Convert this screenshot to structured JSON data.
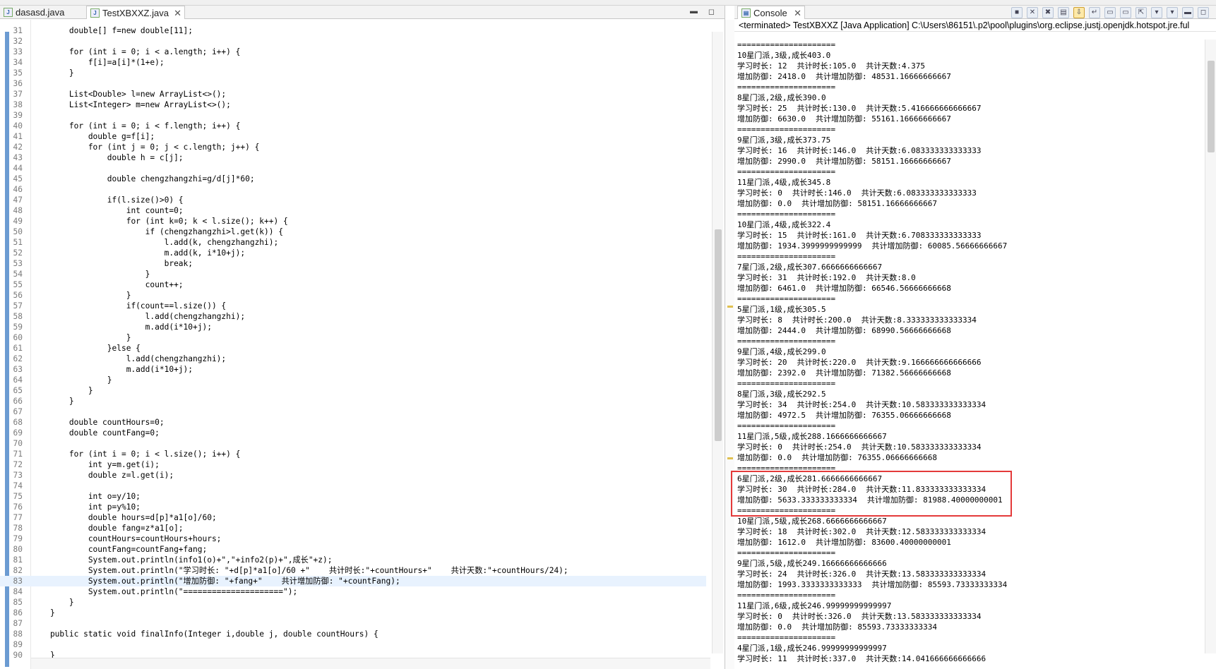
{
  "editor": {
    "tabs": [
      {
        "label": "dasasd.java",
        "active": false
      },
      {
        "label": "TestXBXXZ.java",
        "active": true
      }
    ],
    "code_lines": [
      {
        "n": "31",
        "t": "        double[] f=new double[11];"
      },
      {
        "n": "32",
        "t": ""
      },
      {
        "n": "33",
        "t": "        for (int i = 0; i < a.length; i++) {"
      },
      {
        "n": "34",
        "t": "            f[i]=a[i]*(1+e);"
      },
      {
        "n": "35",
        "t": "        }"
      },
      {
        "n": "36",
        "t": ""
      },
      {
        "n": "37",
        "t": "        List<Double> l=new ArrayList<>();"
      },
      {
        "n": "38",
        "t": "        List<Integer> m=new ArrayList<>();"
      },
      {
        "n": "39",
        "t": ""
      },
      {
        "n": "40",
        "t": "        for (int i = 0; i < f.length; i++) {"
      },
      {
        "n": "41",
        "t": "            double g=f[i];"
      },
      {
        "n": "42",
        "t": "            for (int j = 0; j < c.length; j++) {"
      },
      {
        "n": "43",
        "t": "                double h = c[j];"
      },
      {
        "n": "44",
        "t": ""
      },
      {
        "n": "45",
        "t": "                double chengzhangzhi=g/d[j]*60;"
      },
      {
        "n": "46",
        "t": ""
      },
      {
        "n": "47",
        "t": "                if(l.size()>0) {"
      },
      {
        "n": "48",
        "t": "                    int count=0;"
      },
      {
        "n": "49",
        "t": "                    for (int k=0; k < l.size(); k++) {"
      },
      {
        "n": "50",
        "t": "                        if (chengzhangzhi>l.get(k)) {"
      },
      {
        "n": "51",
        "t": "                            l.add(k, chengzhangzhi);"
      },
      {
        "n": "52",
        "t": "                            m.add(k, i*10+j);"
      },
      {
        "n": "53",
        "t": "                            break;"
      },
      {
        "n": "54",
        "t": "                        }"
      },
      {
        "n": "55",
        "t": "                        count++;"
      },
      {
        "n": "56",
        "t": "                    }"
      },
      {
        "n": "57",
        "t": "                    if(count==l.size()) {"
      },
      {
        "n": "58",
        "t": "                        l.add(chengzhangzhi);"
      },
      {
        "n": "59",
        "t": "                        m.add(i*10+j);"
      },
      {
        "n": "60",
        "t": "                    }"
      },
      {
        "n": "61",
        "t": "                }else {"
      },
      {
        "n": "62",
        "t": "                    l.add(chengzhangzhi);"
      },
      {
        "n": "63",
        "t": "                    m.add(i*10+j);"
      },
      {
        "n": "64",
        "t": "                }"
      },
      {
        "n": "65",
        "t": "            }"
      },
      {
        "n": "66",
        "t": "        }"
      },
      {
        "n": "67",
        "t": ""
      },
      {
        "n": "68",
        "t": "        double countHours=0;"
      },
      {
        "n": "69",
        "t": "        double countFang=0;"
      },
      {
        "n": "70",
        "t": ""
      },
      {
        "n": "71",
        "t": "        for (int i = 0; i < l.size(); i++) {"
      },
      {
        "n": "72",
        "t": "            int y=m.get(i);"
      },
      {
        "n": "73",
        "t": "            double z=l.get(i);"
      },
      {
        "n": "74",
        "t": ""
      },
      {
        "n": "75",
        "t": "            int o=y/10;"
      },
      {
        "n": "76",
        "t": "            int p=y%10;"
      },
      {
        "n": "77",
        "t": "            double hours=d[p]*a1[o]/60;"
      },
      {
        "n": "78",
        "t": "            double fang=z*a1[o];"
      },
      {
        "n": "79",
        "t": "            countHours=countHours+hours;"
      },
      {
        "n": "80",
        "t": "            countFang=countFang+fang;"
      },
      {
        "n": "81",
        "t": "            System.out.println(info1(o)+\",\"+info2(p)+\",成长\"+z);"
      },
      {
        "n": "82",
        "t": "            System.out.println(\"学习时长: \"+d[p]*a1[o]/60 +\"    共计时长:\"+countHours+\"    共计天数:\"+countHours/24);"
      },
      {
        "n": "83",
        "t": "            System.out.println(\"增加防御: \"+fang+\"    共计增加防御: \"+countFang);"
      },
      {
        "n": "84",
        "t": "            System.out.println(\"=====================\");"
      },
      {
        "n": "85",
        "t": "        }"
      },
      {
        "n": "86",
        "t": "    }"
      },
      {
        "n": "87",
        "t": ""
      },
      {
        "n": "88",
        "t": "    public static void finalInfo(Integer i,double j, double countHours) {"
      },
      {
        "n": "89",
        "t": ""
      },
      {
        "n": "90",
        "t": "    }"
      }
    ]
  },
  "console": {
    "tab_label": "Console",
    "header": "<terminated> TestXBXXZ [Java Application] C:\\Users\\86151\\.p2\\pool\\plugins\\org.eclipse.justj.openjdk.hotspot.jre.ful",
    "separator": "=====================",
    "entries": [
      {
        "title": "10星门派,3级,成长403.0",
        "study": "学习时长: 12",
        "total": "共计时长:105.0",
        "days": "共计天数:4.375",
        "defense": "增加防御: 2418.0",
        "total_def": "共计增加防御: 48531.16666666667"
      },
      {
        "title": "8星门派,2级,成长390.0",
        "study": "学习时长: 25",
        "total": "共计时长:130.0",
        "days": "共计天数:5.416666666666667",
        "defense": "增加防御: 6630.0",
        "total_def": "共计增加防御: 55161.16666666667"
      },
      {
        "title": "9星门派,3级,成长373.75",
        "study": "学习时长: 16",
        "total": "共计时长:146.0",
        "days": "共计天数:6.083333333333333",
        "defense": "增加防御: 2990.0",
        "total_def": "共计增加防御: 58151.16666666667"
      },
      {
        "title": "11星门派,4级,成长345.8",
        "study": "学习时长: 0",
        "total": "共计时长:146.0",
        "days": "共计天数:6.083333333333333",
        "defense": "增加防御: 0.0",
        "total_def": "共计增加防御: 58151.16666666667"
      },
      {
        "title": "10星门派,4级,成长322.4",
        "study": "学习时长: 15",
        "total": "共计时长:161.0",
        "days": "共计天数:6.708333333333333",
        "defense": "增加防御: 1934.3999999999999",
        "total_def": "共计增加防御: 60085.56666666667"
      },
      {
        "title": "7星门派,2级,成长307.6666666666667",
        "study": "学习时长: 31",
        "total": "共计时长:192.0",
        "days": "共计天数:8.0",
        "defense": "增加防御: 6461.0",
        "total_def": "共计增加防御: 66546.56666666668"
      },
      {
        "title": "5星门派,1级,成长305.5",
        "study": "学习时长: 8",
        "total": "共计时长:200.0",
        "days": "共计天数:8.333333333333334",
        "defense": "增加防御: 2444.0",
        "total_def": "共计增加防御: 68990.56666666668"
      },
      {
        "title": "9星门派,4级,成长299.0",
        "study": "学习时长: 20",
        "total": "共计时长:220.0",
        "days": "共计天数:9.166666666666666",
        "defense": "增加防御: 2392.0",
        "total_def": "共计增加防御: 71382.56666666668"
      },
      {
        "title": "8星门派,3级,成长292.5",
        "study": "学习时长: 34",
        "total": "共计时长:254.0",
        "days": "共计天数:10.583333333333334",
        "defense": "增加防御: 4972.5",
        "total_def": "共计增加防御: 76355.06666666668"
      },
      {
        "title": "11星门派,5级,成长288.1666666666667",
        "study": "学习时长: 0",
        "total": "共计时长:254.0",
        "days": "共计天数:10.583333333333334",
        "defense": "增加防御: 0.0",
        "total_def": "共计增加防御: 76355.06666666668"
      },
      {
        "title": "6星门派,2级,成长281.6666666666667",
        "study": "学习时长: 30",
        "total": "共计时长:284.0",
        "days": "共计天数:11.833333333333334",
        "defense": "增加防御: 5633.333333333334",
        "total_def": "共计增加防御: 81988.40000000001"
      },
      {
        "title": "10星门派,5级,成长268.6666666666667",
        "study": "学习时长: 18",
        "total": "共计时长:302.0",
        "days": "共计天数:12.583333333333334",
        "defense": "增加防御: 1612.0",
        "total_def": "共计增加防御: 83600.40000000001"
      },
      {
        "title": "9星门派,5级,成长249.16666666666666",
        "study": "学习时长: 24",
        "total": "共计时长:326.0",
        "days": "共计天数:13.583333333333334",
        "defense": "增加防御: 1993.3333333333333",
        "total_def": "共计增加防御: 85593.73333333334"
      },
      {
        "title": "11星门派,6级,成长246.99999999999997",
        "study": "学习时长: 0",
        "total": "共计时长:326.0",
        "days": "共计天数:13.583333333333334",
        "defense": "增加防御: 0.0",
        "total_def": "共计增加防御: 85593.73333333334"
      },
      {
        "title": "4星门派,1级,成长246.99999999999997",
        "study": "学习时长: 11",
        "total": "共计时长:337.0",
        "days": "共计天数:14.041666666666666",
        "defense": "",
        "total_def": ""
      }
    ]
  }
}
